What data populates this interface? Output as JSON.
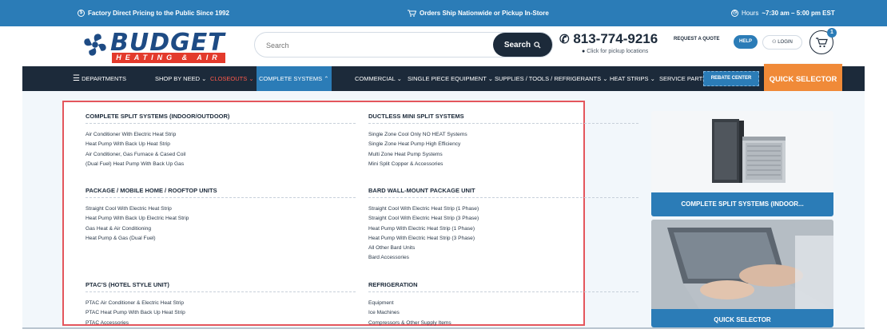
{
  "topbar": {
    "left": "Factory Direct Pricing to the Public Since 1992",
    "center": "Orders Ship Nationwide or Pickup In-Store",
    "hours_label": "Hours",
    "hours_value": "~7:30 am – 5:00 pm EST",
    "colors": {
      "bg": "#2b7cb7"
    }
  },
  "header": {
    "logo_word": "BUDGET",
    "logo_sub": "HEATING & AIR",
    "search_placeholder": "Search",
    "search_button": "Search",
    "phone": "813-774-9216",
    "pickup_link": "Click for pickup locations",
    "request_quote": "REQUEST A QUOTE",
    "help": "HELP",
    "login": "LOGIN",
    "cart_count": "1"
  },
  "nav": {
    "departments": "DEPARTMENTS",
    "items": [
      "SHOP BY NEED",
      "CLOSEOUTS",
      "COMPLETE SYSTEMS",
      "COMMERCIAL",
      "SINGLE PIECE EQUIPMENT",
      "SUPPLIES / TOOLS / REFRIGERANTS",
      "HEAT STRIPS",
      "SERVICE PARTS"
    ],
    "rebate": "REBATE CENTER",
    "quick": "QUICK SELECTOR",
    "colors": {
      "bg": "#1c2a3a",
      "active": "#2b7cb7",
      "closeouts": "#ff5a4a",
      "quick": "#f08a38"
    }
  },
  "menu": {
    "groups": [
      {
        "title": "COMPLETE SPLIT SYSTEMS (INDOOR/OUTDOOR)",
        "links": [
          "Air Conditioner With Electric Heat Strip",
          "Heat Pump With Back Up Heat Strip",
          "Air Conditioner, Gas Furnace & Cased Coil",
          "(Dual Fuel) Heat Pump With Back Up Gas"
        ]
      },
      {
        "title": "DUCTLESS MINI SPLIT SYSTEMS",
        "links": [
          "Single Zone Cool Only NO HEAT Systems",
          "Single Zone Heat Pump High Efficiency",
          "Multi Zone Heat Pump Systems",
          "Mini Split Copper & Accessories"
        ]
      },
      {
        "title": "PACKAGE / MOBILE HOME / ROOFTOP UNITS",
        "links": [
          "Straight Cool With Electric Heat Strip",
          "Heat Pump With Back Up Electric Heat Strip",
          "Gas Heat & Air Conditioning",
          "Heat Pump & Gas (Dual Fuel)"
        ]
      },
      {
        "title": "BARD WALL-MOUNT PACKAGE UNIT",
        "links": [
          "Straight Cool With Electric Heat Strip (1 Phase)",
          "Straight Cool With Electric Heat Strip (3 Phase)",
          "Heat Pump With Electric Heat Strip (1 Phase)",
          "Heat Pump With Electric Heat Strip (3 Phase)",
          "All Other Bard Units",
          "Bard Accessories"
        ]
      },
      {
        "title": "PTAC'S (HOTEL STYLE UNIT)",
        "links": [
          "PTAC Air Conditioner & Electric Heat Strip",
          "PTAC Heat Pump With Back Up Heat Strip",
          "PTAC Accessories"
        ]
      },
      {
        "title": "REFRIGERATION",
        "links": [
          "Equipment",
          "Ice Machines",
          "Compressors & Other Supply Items"
        ]
      }
    ],
    "highlight_color": "#e4565c"
  },
  "cards": [
    {
      "caption": "COMPLETE SPLIT SYSTEMS (INDOOR..."
    },
    {
      "caption": "QUICK SELECTOR"
    }
  ]
}
